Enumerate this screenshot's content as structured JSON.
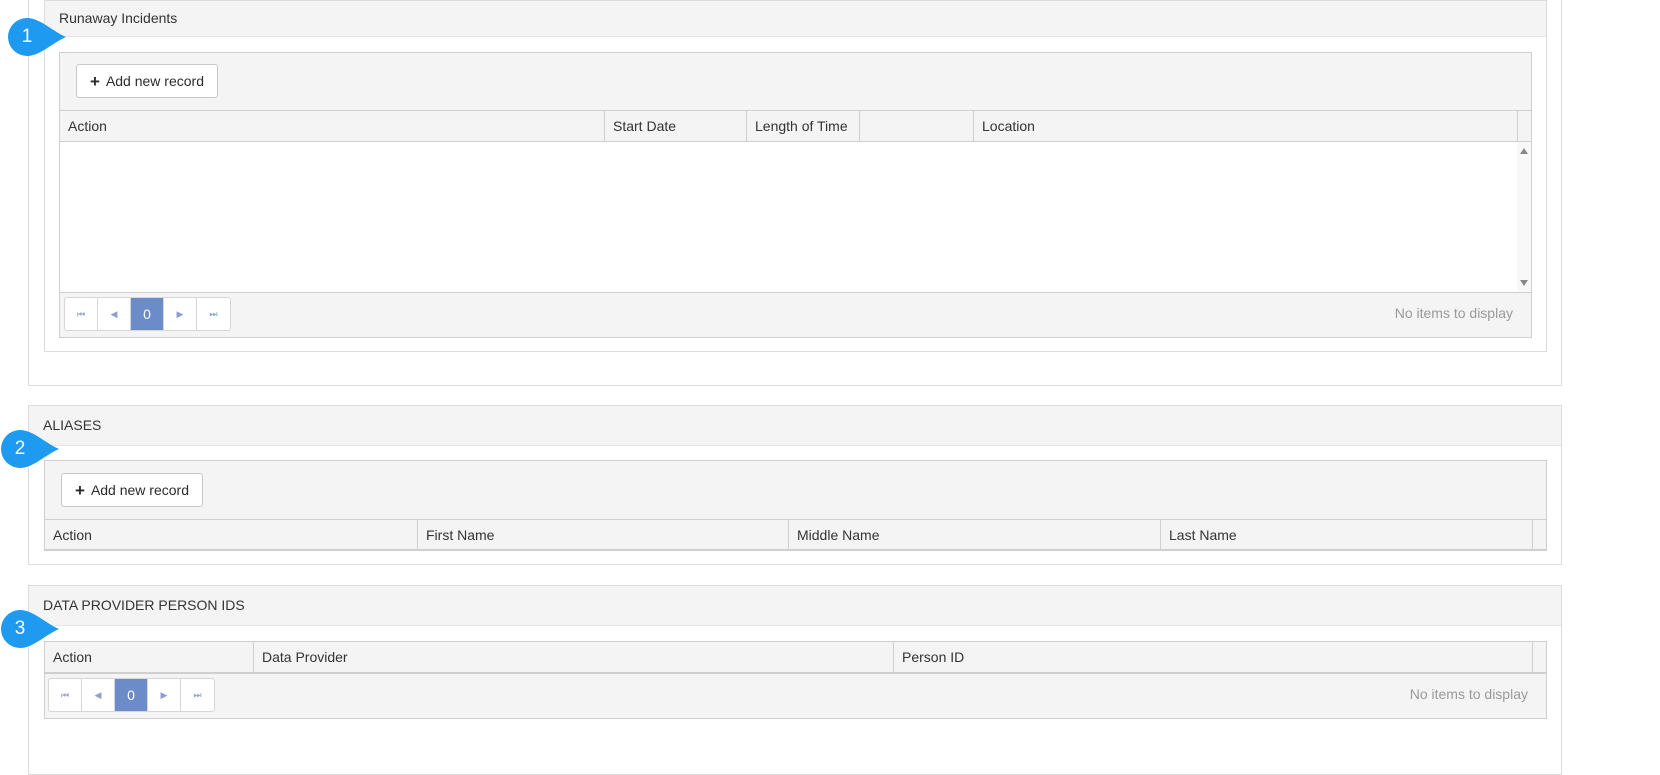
{
  "runaway": {
    "title": "Runaway Incidents",
    "add_label": "Add new record",
    "columns": [
      "Action",
      "Start Date",
      "Length of Time",
      "",
      "Location"
    ],
    "pager": {
      "page": "0",
      "info": "No items to display"
    },
    "badge": "1"
  },
  "aliases": {
    "title": "ALIASES",
    "add_label": "Add new record",
    "columns": [
      "Action",
      "First Name",
      "Middle Name",
      "Last Name"
    ],
    "badge": "2"
  },
  "data_provider": {
    "title": "DATA PROVIDER PERSON IDS",
    "columns": [
      "Action",
      "Data Provider",
      "Person ID"
    ],
    "pager": {
      "page": "0",
      "info": "No items to display"
    },
    "badge": "3"
  },
  "colors": {
    "badge": "#1e9af0",
    "pager_active": "#6b8cc9"
  }
}
